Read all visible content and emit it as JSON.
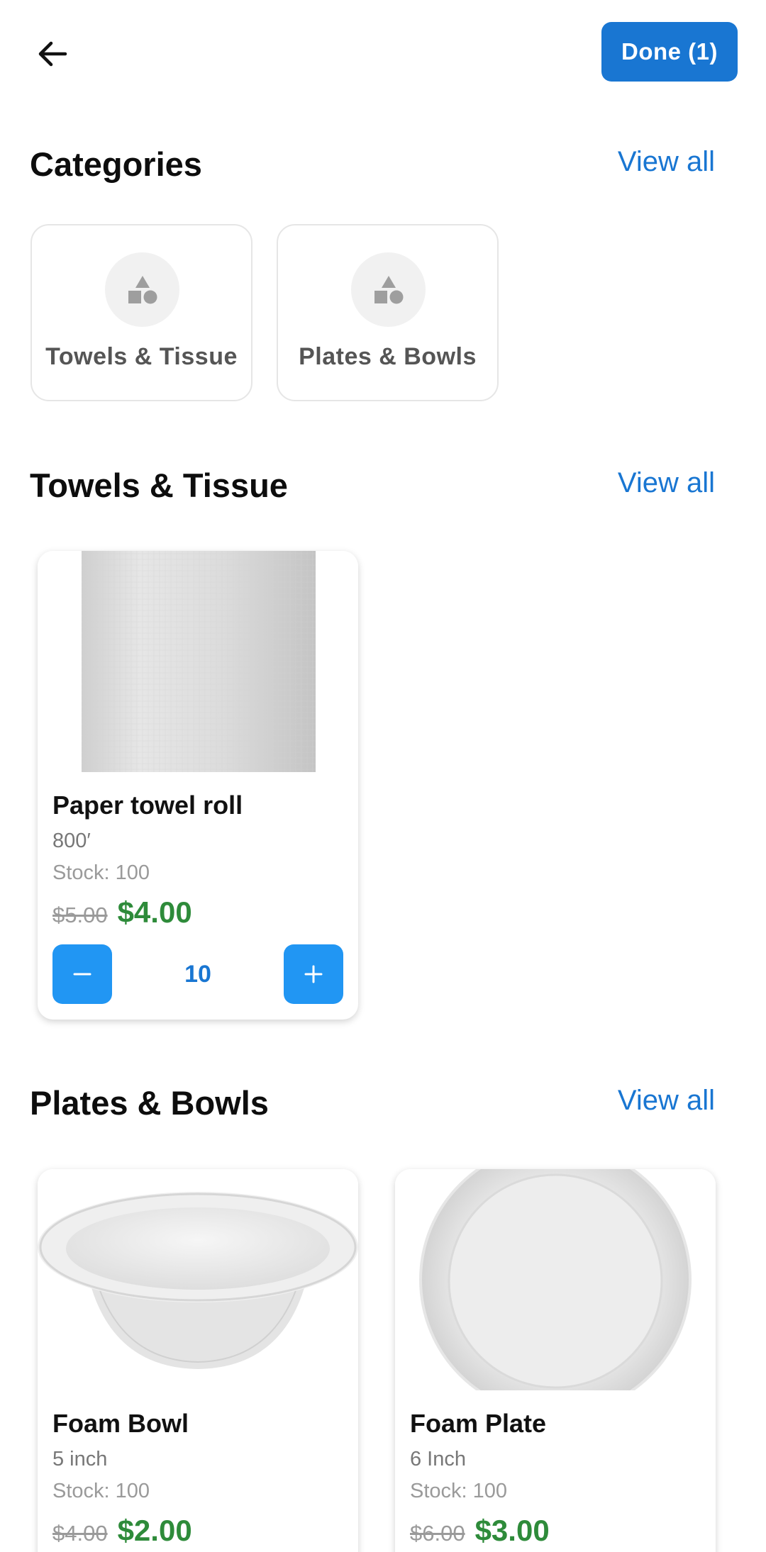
{
  "header": {
    "back_icon": "arrow-left-icon",
    "done_label": "Done (1)"
  },
  "colors": {
    "primary": "#1976d2",
    "qty_button": "#2196f3",
    "price_green": "#2e8b3a",
    "muted_text": "#9a9a9a"
  },
  "categories": {
    "title": "Categories",
    "view_all": "View all",
    "items": [
      {
        "label": "Towels & Tissue",
        "icon": "shapes-icon"
      },
      {
        "label": "Plates & Bowls",
        "icon": "shapes-icon"
      }
    ]
  },
  "towels_section": {
    "title": "Towels & Tissue",
    "view_all": "View all",
    "products": [
      {
        "name": "Paper towel roll",
        "size": "800′",
        "stock": "Stock: 100",
        "price_old": "$5.00",
        "price_new": "$4.00",
        "quantity": "10",
        "image": "paper-towel-roll-image"
      }
    ]
  },
  "plates_section": {
    "title": "Plates & Bowls",
    "view_all": "View all",
    "products": [
      {
        "name": "Foam Bowl",
        "size": "5 inch",
        "stock": "Stock: 100",
        "price_old": "$4.00",
        "price_new": "$2.00",
        "image": "foam-bowl-image"
      },
      {
        "name": "Foam Plate",
        "size": "6 Inch",
        "stock": "Stock: 100",
        "price_old": "$6.00",
        "price_new": "$3.00",
        "image": "foam-plate-image"
      }
    ]
  }
}
